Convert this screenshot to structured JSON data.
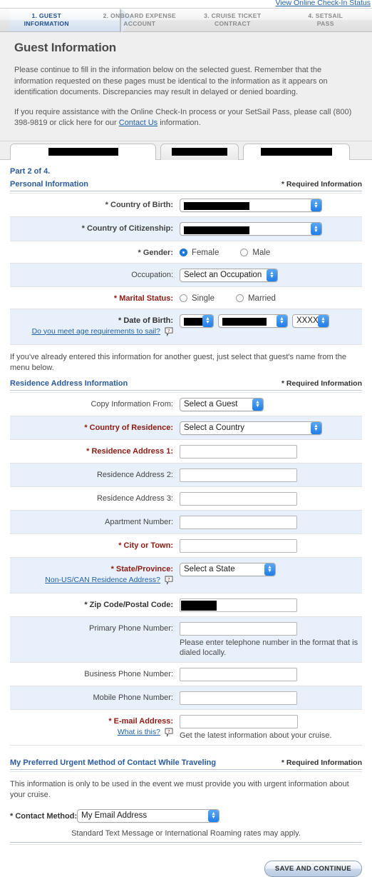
{
  "topbar": {
    "status_link": "View Online Check-In Status"
  },
  "steps": [
    {
      "label": "1. GUEST",
      "label2": "INFORMATION",
      "active": true
    },
    {
      "label": "2. ONBOARD EXPENSE",
      "label2": "ACCOUNT",
      "active": false
    },
    {
      "label": "3. CRUISE TICKET",
      "label2": "CONTRACT",
      "active": false
    },
    {
      "label": "4. SETSAIL",
      "label2": "PASS",
      "active": false
    }
  ],
  "page": {
    "title": "Guest Information",
    "intro_1": "Please continue to fill in the information below on the selected guest. Remember that the information requested on these pages must be identical to the information as it appears on identification documents. Discrepancies may result in delayed or denied boarding.",
    "intro_2_pre": "If you require assistance with the Online Check-In process or your SetSail Pass, please call (800) 398-9819 or click here for our ",
    "intro_2_link": "Contact Us",
    "intro_2_post": " information."
  },
  "guest_tabs": [
    {
      "name": "[redacted]",
      "active": true
    },
    {
      "name": "[redacted]",
      "active": false
    },
    {
      "name": "[redacted]",
      "active": false
    }
  ],
  "part_label": "Part 2 of 4.",
  "personal": {
    "title": "Personal Information",
    "required_note": "* Required Information",
    "country_of_birth_label": "* Country of Birth:",
    "country_of_birth_value": "[redacted]",
    "country_of_citizenship_label": "* Country of Citizenship:",
    "country_of_citizenship_value": "[redacted]",
    "gender_label": "* Gender:",
    "gender_female": "Female",
    "gender_male": "Male",
    "gender_selected": "Female",
    "occupation_label": "Occupation:",
    "occupation_value": "Select an Occupation",
    "marital_status_label": "* Marital Status:",
    "marital_single": "Single",
    "marital_married": "Married",
    "dob_label": "* Date of Birth:",
    "dob_sub_link": "Do you meet age requirements to sail?",
    "dob_month": "[redacted]",
    "dob_day": "[redacted]",
    "dob_year": "XXXX"
  },
  "copy_note": "If you've already entered this information for another guest, just select that guest's name from the menu below.",
  "residence": {
    "title": "Residence Address Information",
    "required_note": "* Required Information",
    "copy_from_label": "Copy Information From:",
    "copy_from_value": "Select a Guest",
    "country_label": "* Country of Residence:",
    "country_value": "Select a Country",
    "address1_label": "* Residence Address 1:",
    "address1_value": "",
    "address2_label": "Residence Address 2:",
    "address2_value": "",
    "address3_label": "Residence Address 3:",
    "address3_value": "",
    "apartment_label": "Apartment Number:",
    "apartment_value": "",
    "city_label": "* City or Town:",
    "city_value": "",
    "state_label": "* State/Province:",
    "state_sub_link": "Non-US/CAN Residence Address?",
    "state_value": "Select a State",
    "zip_label": "* Zip Code/Postal Code:",
    "zip_value": "[redacted]",
    "primary_phone_label": "Primary Phone Number:",
    "primary_phone_value": "",
    "primary_phone_hint": "Please enter telephone number in the format that is dialed locally.",
    "business_phone_label": "Business Phone Number:",
    "business_phone_value": "",
    "mobile_phone_label": "Mobile Phone Number:",
    "mobile_phone_value": "",
    "email_label": "* E-mail Address:",
    "email_sub_link": "What is this?",
    "email_value": "",
    "email_hint": "Get the latest information about your cruise."
  },
  "urgent": {
    "title": "My Preferred Urgent Method of Contact While Traveling",
    "required_note": "* Required Information",
    "note": "This information is only to be used in the event we must provide you with urgent information about your cruise.",
    "contact_method_label": "* Contact Method:",
    "contact_method_value": "My Email Address",
    "standard_note": "Standard Text Message or International Roaming rates may apply."
  },
  "footer": {
    "save_label": "SAVE AND CONTINUE"
  },
  "colors": {
    "accent_blue": "#2a5b9c",
    "link_blue": "#1f5fa9",
    "required_red": "#8f1a11",
    "select_button": "#1f7ee8",
    "row_alt": "#e8f1fb"
  }
}
